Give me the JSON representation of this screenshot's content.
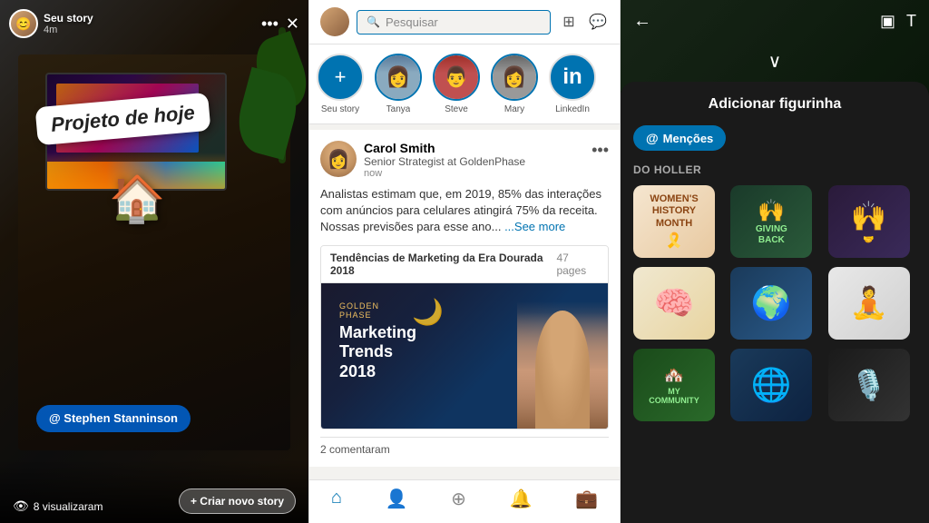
{
  "panel1": {
    "user": "Seu story",
    "time": "4m",
    "sticker_text": "Projeto de hoje",
    "mention_text": "@ Stephen Stanninson",
    "views_count": "8 visualizaram",
    "new_story_btn": "+ Criar novo story",
    "dots": "•••",
    "close": "✕"
  },
  "panel2": {
    "search_placeholder": "Pesquisar",
    "stories": [
      {
        "label": "Seu story",
        "type": "add"
      },
      {
        "label": "Tanya",
        "type": "ring"
      },
      {
        "label": "Steve",
        "type": "ring"
      },
      {
        "label": "Mary",
        "type": "ring"
      },
      {
        "label": "LinkedIn",
        "type": "linkedin"
      }
    ],
    "post": {
      "author_name": "Carol Smith",
      "author_title": "Senior Strategist at GoldenPhase",
      "time": "now",
      "body": "Analistas estimam que, em 2019, 85% das interações com anúncios para celulares atingirá 75% da receita. Nossas previsões para esse ano...",
      "see_more": "...See more",
      "doc_title": "Tendências de Marketing da Era Dourada 2018",
      "doc_pages": "47 pages",
      "doc_brand": "GOLDEN\nPHASE",
      "doc_text_line1": "Marketing",
      "doc_text_line2": "Trends",
      "doc_text_line3": "2018",
      "comments": "2 comentaram",
      "more_icon": "•••"
    },
    "nav": {
      "home": "⌂",
      "people": "👤",
      "plus": "➕",
      "bell": "🔔",
      "briefcase": "💼"
    }
  },
  "panel3": {
    "back_icon": "←",
    "icon1": "▣",
    "icon2": "T",
    "chevron": "∨",
    "title": "Adicionar figurinha",
    "mentions_label": "Menções",
    "section_label": "Do Holler",
    "stickers": [
      {
        "id": "whm",
        "emoji": "🎗️",
        "label": "WOMEN'S HISTORY MONTH"
      },
      {
        "id": "giving",
        "emoji": "🙌",
        "label": "GIVING BACK"
      },
      {
        "id": "hands",
        "emoji": "🙌",
        "label": "hands"
      },
      {
        "id": "brain",
        "emoji": "🧠",
        "label": "brain"
      },
      {
        "id": "earth",
        "emoji": "🌍",
        "label": "earth"
      },
      {
        "id": "person",
        "emoji": "🧘",
        "label": "person"
      },
      {
        "id": "community",
        "emoji": "🏘️",
        "label": "MY COMMUNITY"
      },
      {
        "id": "globe2",
        "emoji": "🌐",
        "label": "globe"
      },
      {
        "id": "speaker",
        "emoji": "🎙️",
        "label": "speaker"
      }
    ]
  }
}
